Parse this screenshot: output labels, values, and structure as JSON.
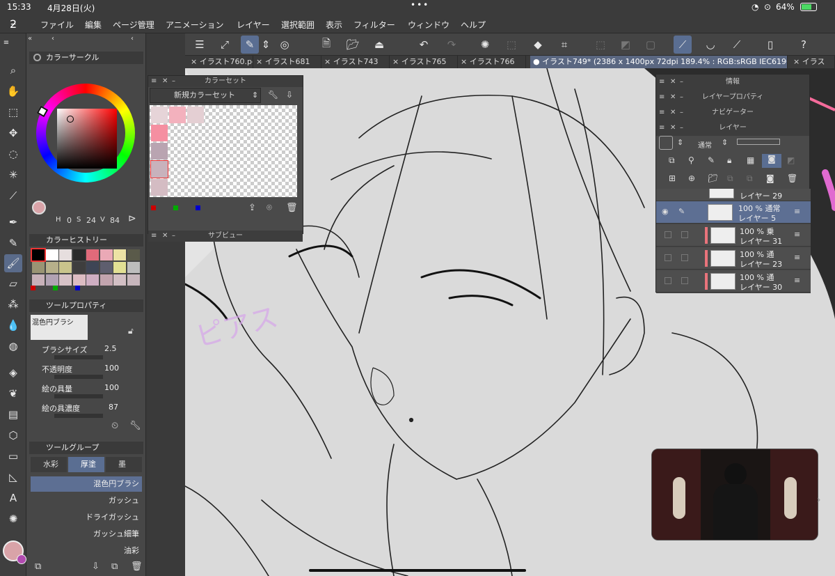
{
  "status": {
    "time": "15:33",
    "date": "4月28日(火)",
    "battery": "64%"
  },
  "menu": [
    "ファイル",
    "編集",
    "ページ管理",
    "アニメーション",
    "レイヤー",
    "選択範囲",
    "表示",
    "フィルター",
    "ウィンドウ",
    "ヘルプ"
  ],
  "tabs": [
    {
      "label": "× イラスト760.pe",
      "active": false
    },
    {
      "label": "× イラスト681",
      "active": false
    },
    {
      "label": "× イラスト743",
      "active": false
    },
    {
      "label": "× イラスト765",
      "active": false
    },
    {
      "label": "× イラスト766",
      "active": false
    },
    {
      "label": "● イラスト749* (2386 x 1400px 72dpi 189.4% : RGB:sRGB IEC61966-2.1)",
      "active": true
    },
    {
      "label": "× イラス",
      "active": false
    }
  ],
  "color_circle": {
    "title": "カラーサークル",
    "h": "0",
    "s": "24",
    "v": "84",
    "h_label": "H",
    "s_label": "S",
    "v_label": "V",
    "main_color": "#d9a3a8"
  },
  "color_history": {
    "title": "カラーヒストリー",
    "colors": [
      "#000000",
      "#ffffff",
      "#e6dede",
      "#2a2a2a",
      "#e06a7a",
      "#eaa9b6",
      "#ece2a4",
      "#5a5a4a",
      "#9a9474",
      "#b7b08a",
      "#c9c48c",
      "#3e3e3e",
      "#3e4555",
      "#5e5e6e",
      "#e2e094",
      "#bdbdbd",
      "#c8b1b9",
      "#b1a2b3",
      "#d7c2c7",
      "#dcbcc2",
      "#ceaec2",
      "#c2a4ae",
      "#d2bfc4",
      "#c7b6bc"
    ]
  },
  "tool_property": {
    "title": "ツールプロパティ",
    "brush_name": "混色円ブラシ",
    "rows": [
      {
        "label": "ブラシサイズ",
        "value": "2.5"
      },
      {
        "label": "不透明度",
        "value": "100"
      },
      {
        "label": "絵の具量",
        "value": "100"
      },
      {
        "label": "絵の具濃度",
        "value": "87"
      }
    ]
  },
  "tool_group": {
    "title": "ツールグループ",
    "tabs": [
      "水彩",
      "厚塗",
      "墨"
    ],
    "brushes": [
      "混色円ブラシ",
      "ガッシュ",
      "ドライガッシュ",
      "ガッシュ細筆",
      "油彩"
    ]
  },
  "color_set": {
    "title": "カラーセット",
    "set_name": "新規カラーセット",
    "swatches": [
      "#e6d4d8",
      "#f3b1bd",
      "#e4cfd3",
      "#f58fa1",
      "#b9a4b1",
      "#c8b2bc",
      "#d4bcc3"
    ]
  },
  "sub_view": {
    "title": "サブビュー"
  },
  "right_panels": {
    "info": "情報",
    "layer_property": "レイヤープロパティ",
    "navigator": "ナビゲーター",
    "layer": "レイヤー",
    "blend": "通常"
  },
  "layers": [
    {
      "opacity": "",
      "name": "レイヤー 29",
      "selected": false
    },
    {
      "opacity": "100 % 通常",
      "name": "レイヤー 5",
      "selected": true
    },
    {
      "opacity": "100 % 乗",
      "name": "レイヤー 31",
      "selected": false
    },
    {
      "opacity": "100 % 通",
      "name": "レイヤー 23",
      "selected": false
    },
    {
      "opacity": "100 % 通",
      "name": "レイヤー 30",
      "selected": false
    }
  ],
  "watermark": "ピアス"
}
